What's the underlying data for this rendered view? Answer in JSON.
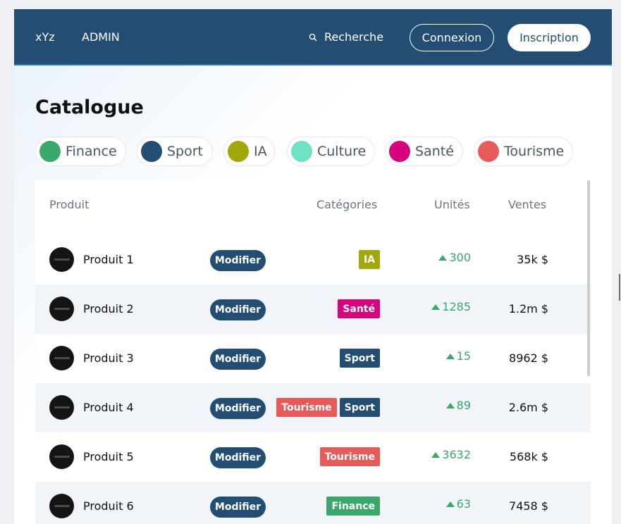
{
  "navbar": {
    "brand": "xYz",
    "admin": "ADMIN",
    "search_label": "Recherche",
    "login_label": "Connexion",
    "signup_label": "Inscription"
  },
  "page_title": "Catalogue",
  "filters": [
    {
      "label": "Finance",
      "color": "#3aa86b"
    },
    {
      "label": "Sport",
      "color": "#234d72"
    },
    {
      "label": "IA",
      "color": "#a1a80a"
    },
    {
      "label": "Culture",
      "color": "#6ee2c2"
    },
    {
      "label": "Santé",
      "color": "#d8007c"
    },
    {
      "label": "Tourisme",
      "color": "#e75a5a"
    }
  ],
  "table": {
    "headers": {
      "product": "Produit",
      "categories": "Catégories",
      "units": "Unités",
      "sales": "Ventes"
    },
    "edit_label": "Modifier",
    "rows": [
      {
        "name": "Produit 1",
        "tags": [
          {
            "label": "IA",
            "color": "#a1a80a"
          }
        ],
        "units": "300",
        "sales": "35k $"
      },
      {
        "name": "Produit 2",
        "tags": [
          {
            "label": "Santé",
            "color": "#d8007c"
          }
        ],
        "units": "1285",
        "sales": "1.2m $"
      },
      {
        "name": "Produit 3",
        "tags": [
          {
            "label": "Sport",
            "color": "#234d72"
          }
        ],
        "units": "15",
        "sales": "8962 $"
      },
      {
        "name": "Produit 4",
        "tags": [
          {
            "label": "Tourisme",
            "color": "#e75a5a"
          },
          {
            "label": "Sport",
            "color": "#234d72"
          }
        ],
        "units": "89",
        "sales": "2.6m $"
      },
      {
        "name": "Produit 5",
        "tags": [
          {
            "label": "Tourisme",
            "color": "#e75a5a"
          }
        ],
        "units": "3632",
        "sales": "568k $"
      },
      {
        "name": "Produit 6",
        "tags": [
          {
            "label": "Finance",
            "color": "#3aa86b"
          }
        ],
        "units": "63",
        "sales": "7458 $"
      }
    ]
  }
}
